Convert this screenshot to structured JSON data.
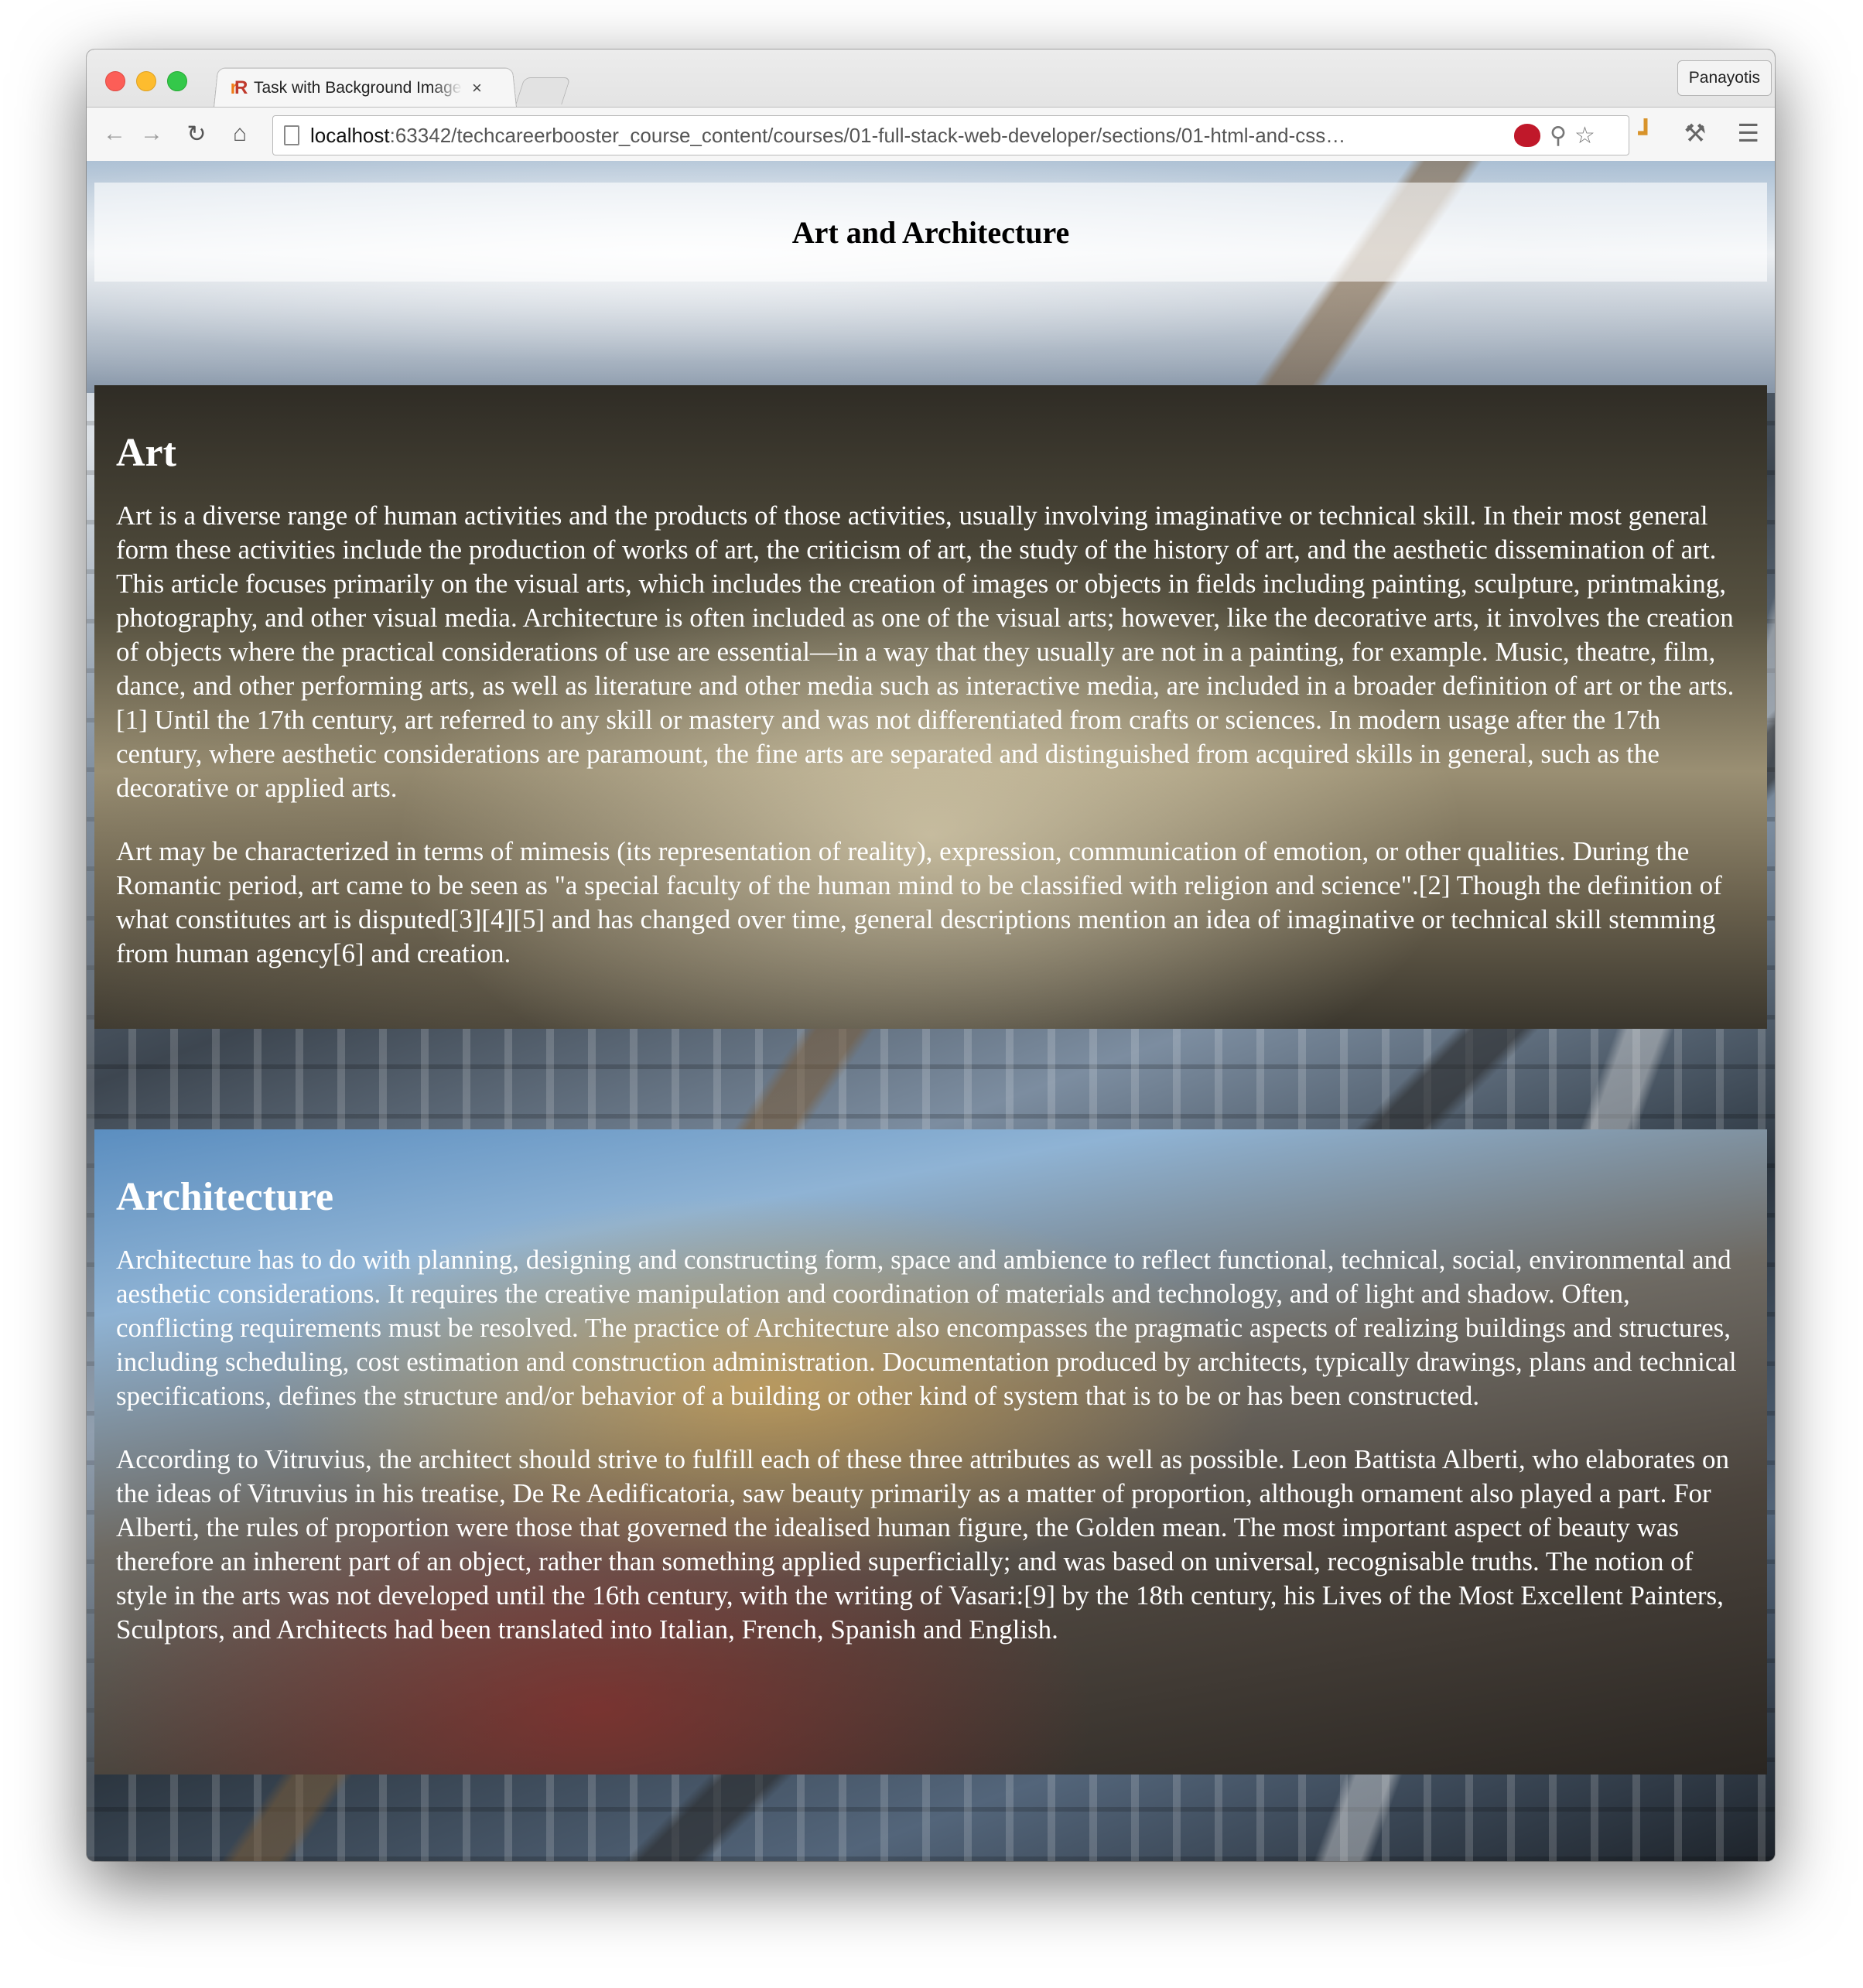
{
  "browser": {
    "tab_title": "Task with Background Image",
    "tab_close": "×",
    "profile_name": "Panayotis",
    "url_host": "localhost",
    "url_rest": ":63342/techcareerbooster_course_content/courses/01-full-stack-web-developer/sections/01-html-and-css…",
    "icons": {
      "back": "back-arrow-icon",
      "forward": "forward-arrow-icon",
      "reload": "reload-icon",
      "home": "home-icon",
      "search": "search-icon",
      "star": "star-icon",
      "menu": "menu-icon"
    }
  },
  "page": {
    "header_title": "Art and Architecture",
    "sections": [
      {
        "heading": "Art",
        "paragraphs": [
          "Art is a diverse range of human activities and the products of those activities, usually involving imaginative or technical skill. In their most general form these activities include the production of works of art, the criticism of art, the study of the history of art, and the aesthetic dissemination of art. This article focuses primarily on the visual arts, which includes the creation of images or objects in fields including painting, sculpture, printmaking, photography, and other visual media. Architecture is often included as one of the visual arts; however, like the decorative arts, it involves the creation of objects where the practical considerations of use are essential—in a way that they usually are not in a painting, for example. Music, theatre, film, dance, and other performing arts, as well as literature and other media such as interactive media, are included in a broader definition of art or the arts.[1] Until the 17th century, art referred to any skill or mastery and was not differentiated from crafts or sciences. In modern usage after the 17th century, where aesthetic considerations are paramount, the fine arts are separated and distinguished from acquired skills in general, such as the decorative or applied arts.",
          "Art may be characterized in terms of mimesis (its representation of reality), expression, communication of emotion, or other qualities. During the Romantic period, art came to be seen as \"a special faculty of the human mind to be classified with religion and science\".[2] Though the definition of what constitutes art is disputed[3][4][5] and has changed over time, general descriptions mention an idea of imaginative or technical skill stemming from human agency[6] and creation."
        ]
      },
      {
        "heading": "Architecture",
        "paragraphs": [
          "Architecture has to do with planning, designing and constructing form, space and ambience to reflect functional, technical, social, environmental and aesthetic considerations. It requires the creative manipulation and coordination of materials and technology, and of light and shadow. Often, conflicting requirements must be resolved. The practice of Architecture also encompasses the pragmatic aspects of realizing buildings and structures, including scheduling, cost estimation and construction administration. Documentation produced by architects, typically drawings, plans and technical specifications, defines the structure and/or behavior of a building or other kind of system that is to be or has been constructed.",
          "According to Vitruvius, the architect should strive to fulfill each of these three attributes as well as possible. Leon Battista Alberti, who elaborates on the ideas of Vitruvius in his treatise, De Re Aedificatoria, saw beauty primarily as a matter of proportion, although ornament also played a part. For Alberti, the rules of proportion were those that governed the idealised human figure, the Golden mean. The most important aspect of beauty was therefore an inherent part of an object, rather than something applied superficially; and was based on universal, recognisable truths. The notion of style in the arts was not developed until the 16th century, with the writing of Vasari:[9] by the 18th century, his Lives of the Most Excellent Painters, Sculptors, and Architects had been translated into Italian, French, Spanish and English."
        ]
      }
    ]
  }
}
